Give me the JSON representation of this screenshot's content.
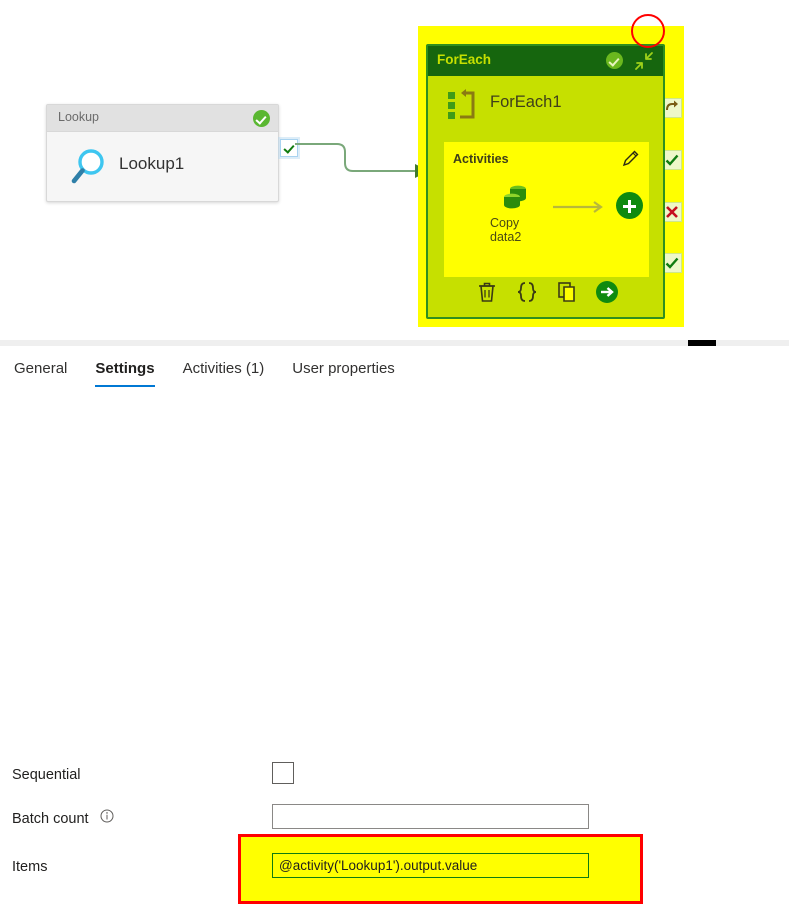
{
  "canvas": {
    "lookup_card": {
      "header_title": "Lookup",
      "activity_name": "Lookup1",
      "status_icon": "green-check-circle",
      "type_icon": "magnifier-icon"
    },
    "connector": {
      "output_node_icon": "green-check-icon",
      "arrow_icon": "arrowhead-right-icon"
    },
    "foreach_card": {
      "header_title": "ForEach",
      "activity_name": "ForEach1",
      "status_icon": "green-check-circle",
      "collapse_icon": "collapse-diagonal-arrows-icon",
      "type_icon": "foreach-loop-icon",
      "activities_section": {
        "label": "Activities",
        "edit_icon": "pencil-icon",
        "inner_activity": {
          "name_line1": "Copy",
          "name_line2": "data2",
          "icon": "copy-data-icon"
        },
        "flow_arrow_icon": "arrow-right-icon",
        "add_button_icon": "plus-circle-icon"
      },
      "toolbar": [
        {
          "name": "delete",
          "icon": "trash-icon"
        },
        {
          "name": "code",
          "icon": "curly-braces-icon"
        },
        {
          "name": "clone",
          "icon": "copy-pages-icon"
        },
        {
          "name": "run",
          "icon": "arrow-right-circle-icon"
        }
      ]
    },
    "edge_connectors": [
      {
        "name": "skip",
        "icon": "skip-arrow-icon"
      },
      {
        "name": "success-1",
        "icon": "check-icon"
      },
      {
        "name": "failure",
        "icon": "red-x-icon"
      },
      {
        "name": "success-2",
        "icon": "check-icon"
      }
    ],
    "annotations": {
      "red_circle": "red-circle-highlight",
      "highlight_color": "#ffff00",
      "annotation_color": "#ff0000"
    }
  },
  "panel": {
    "tabs": [
      {
        "label": "General",
        "active": false
      },
      {
        "label": "Settings",
        "active": true
      },
      {
        "label": "Activities (1)",
        "active": false
      },
      {
        "label": "User properties",
        "active": false
      }
    ],
    "fields": {
      "sequential": {
        "label": "Sequential",
        "checked": false
      },
      "batch_count": {
        "label": "Batch count",
        "info_icon": "info-circle-icon",
        "value": "",
        "placeholder": ""
      },
      "items": {
        "label": "Items",
        "value": "@activity('Lookup1').output.value",
        "placeholder": ""
      }
    }
  },
  "colors": {
    "accent": "#0078d4",
    "success": "#107c10",
    "highlight": "#ffff00",
    "annotation": "#ff0000",
    "foreach_header": "#16660e",
    "foreach_body": "#c6e000"
  }
}
